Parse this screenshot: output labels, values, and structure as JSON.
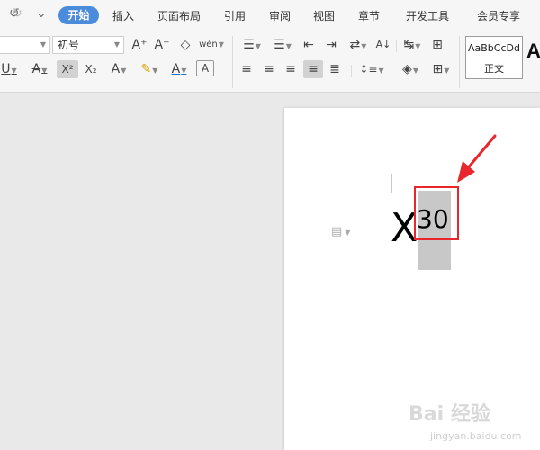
{
  "quick_access": {
    "undo_icon": "↺",
    "redo_icon": "↻",
    "more_icon": "⌄"
  },
  "menu": {
    "tabs": [
      "开始",
      "插入",
      "页面布局",
      "引用",
      "审阅",
      "视图",
      "章节",
      "开发工具",
      "会员专享"
    ],
    "active": "开始",
    "accent": "#4a8bdc"
  },
  "ribbon": {
    "font_size": "初号",
    "buttons": {
      "grow_font": "A⁺",
      "shrink_font": "A⁻",
      "clear_format": "◇",
      "phonetic": "wén",
      "underline": "U",
      "strikethrough": "A",
      "superscript": "X²",
      "subscript": "X₂",
      "text_effect": "A",
      "highlight": "✎",
      "font_color": "A",
      "char_border": "A",
      "bullets": "☰",
      "numbering": "☰",
      "outdent": "⇤",
      "indent": "⇥",
      "text_direction": "⇄",
      "sort": "A↓",
      "line_spacing_tool": "↹",
      "distribute": "⊞",
      "align_left": "≡",
      "align_center": "≡",
      "align_right": "≡",
      "justify": "≡",
      "distributed": "≣",
      "line_spacing": "↕≡",
      "shading": "◈",
      "borders": "⊞"
    },
    "superscript_selected": true,
    "styles": {
      "normal_preview": "AaBbCcDd",
      "normal_name": "正文",
      "heading_preview": "A"
    }
  },
  "document": {
    "base_text": "X",
    "superscript_text": "30",
    "paste_options_icon": "▤"
  },
  "annotation": {
    "color": "#e8262b"
  },
  "watermark": {
    "brand": "Bai 经验",
    "sub": "",
    "url": "jingyan.baidu.com"
  }
}
